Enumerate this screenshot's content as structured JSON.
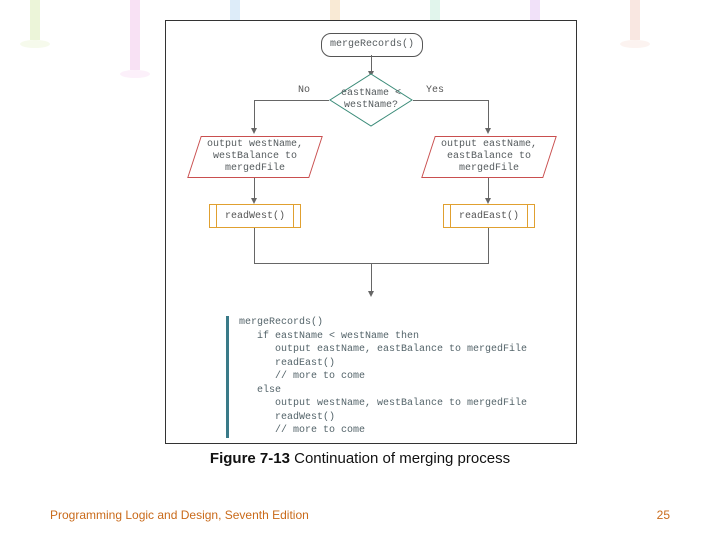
{
  "flow": {
    "start": "mergeRecords()",
    "decision": "eastName <\nwestName?",
    "noLabel": "No",
    "yesLabel": "Yes",
    "noOutput": "output westName,\nwestBalance to\nmergedFile",
    "yesOutput": "output eastName,\neastBalance to\nmergedFile",
    "noCall": "readWest()",
    "yesCall": "readEast()"
  },
  "pseudo": "mergeRecords()\n   if eastName < westName then\n      output eastName, eastBalance to mergedFile\n      readEast()\n      // more to come\n   else\n      output westName, westBalance to mergedFile\n      readWest()\n      // more to come",
  "caption": {
    "figno": "Figure 7-13",
    "text": " Continuation of merging process"
  },
  "footer": {
    "book": "Programming Logic and Design, Seventh Edition",
    "page": "25"
  },
  "bg_colors": [
    "#b5d96b",
    "#e58bd6",
    "#7db5e8",
    "#e8b05a",
    "#8bd9b5",
    "#c98be8",
    "#e8a38b"
  ]
}
